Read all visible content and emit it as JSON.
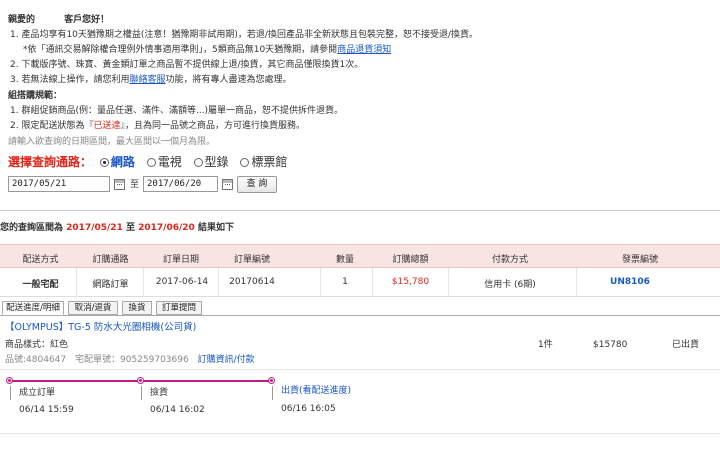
{
  "notice": {
    "greeting_a": "親愛的",
    "greeting_b": "客戶您好！",
    "items": [
      "1.  產品均享有10天猶豫期之權益(注意！猶豫期非試用期)，若退/換回產品非全新狀態且包裝完整，恕不接受退/換貨。",
      "*依「通訊交易解除權合理例外情事適用準則」，5類商品無10天猶豫期，請參閱",
      "2.  下載版序號、珠寶、黃金類訂單之商品暫不提供線上退/換貨，其它商品僅限換貨1次。",
      "3.  若無法線上操作，請您利用",
      "，將有專人盡速為您處理。"
    ],
    "item1b_link": "商品退貨須知",
    "item3_link": "聯絡客服",
    "item3_suffix": "功能",
    "bundle_title": "組搭購規範：",
    "bundle_items": [
      "1.  群組促銷商品(例：量品任選、滿件、滿額等...)屬單一商品，恕不提供拆件退貨。",
      "2.  限定配送狀態為『",
      "』，且為同一品號之商品，方可進行換貨服務。"
    ],
    "delivered_status": "已送達",
    "date_hint": "請輸入欲查詢的日期區間，最大區間以一個月為限。"
  },
  "query": {
    "label": "選擇查詢通路：",
    "channels": [
      "網路",
      "電視",
      "型錄",
      "標票館"
    ],
    "selected_index": 0,
    "start_date": "2017/05/21",
    "to_label": "至",
    "end_date": "2017/06/20",
    "search_label": "查 詢"
  },
  "result": {
    "prefix": "您的查詢區間為",
    "start": "2017/05/21",
    "mid": "至",
    "end": "2017/06/20",
    "suffix": "結果如下"
  },
  "table": {
    "headers": [
      "配送方式",
      "訂購通路",
      "訂單日期",
      "訂單編號",
      "數量",
      "訂購總額",
      "付款方式",
      "發票編號"
    ],
    "row": {
      "shipping": "一般宅配",
      "channel": "網路訂單",
      "date": "2017-06-14",
      "order_no": "20170614",
      "qty": "1",
      "total": "$15,780",
      "payment": "信用卡 (6期)",
      "invoice": "UN8106"
    }
  },
  "tabs": [
    "配送進度/明細",
    "取消/退貨",
    "換貨",
    "訂單提問"
  ],
  "product": {
    "name": "【OLYMPUS】TG-5 防水大光圈相機(公司貨)",
    "spec": "商品樣式：紅色",
    "code": "品號:4804647",
    "shipping_no_label": "宅配單號：905259703696",
    "info_link": "訂購資訊/付款",
    "qty": "1件",
    "price": "$15780",
    "status": "已出貨"
  },
  "timeline": [
    {
      "label": "成立訂單",
      "time": "06/14 15:59"
    },
    {
      "label": "撿貨",
      "time": "06/14 16:02"
    },
    {
      "label": "出貨(看配送進度)",
      "time": "06/16 16:05"
    }
  ],
  "colors": {
    "accent_red": "#e0261a",
    "link_blue": "#1a57c9",
    "header_pink": "#f9e4e4",
    "timeline_magenta": "#c21e86"
  }
}
